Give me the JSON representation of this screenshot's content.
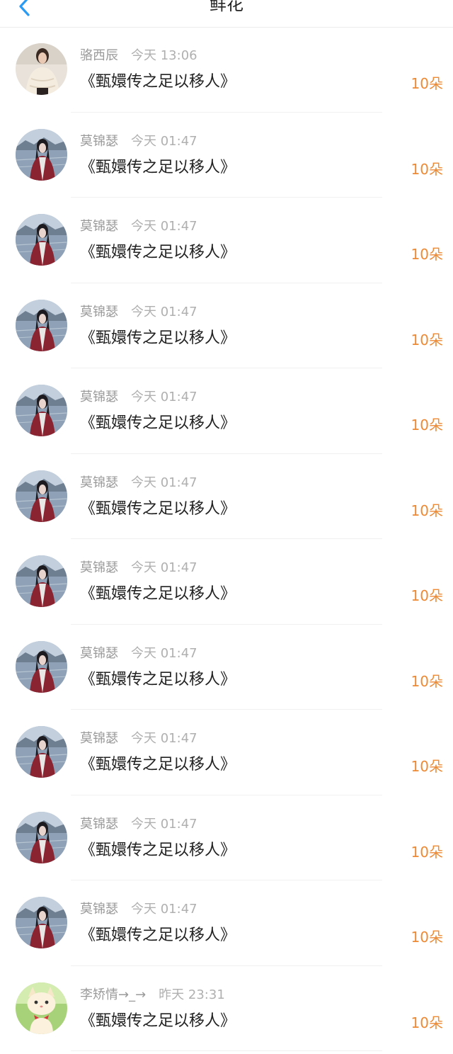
{
  "header": {
    "title": "鲜花",
    "back_icon": "chevron-left-icon",
    "accent": "#2b9af3"
  },
  "colors": {
    "amount": "#ec8a35",
    "name": "#9a9a9a",
    "text": "#222222"
  },
  "gifts": [
    {
      "user": "骆西辰",
      "time": "今天 13:06",
      "work": "《甄嬛传之足以移人》",
      "amount": "10朵",
      "avatar": "woman-lace-top-avatar"
    },
    {
      "user": "莫锦瑟",
      "time": "今天 01:47",
      "work": "《甄嬛传之足以移人》",
      "amount": "10朵",
      "avatar": "woman-lakeside-avatar"
    },
    {
      "user": "莫锦瑟",
      "time": "今天 01:47",
      "work": "《甄嬛传之足以移人》",
      "amount": "10朵",
      "avatar": "woman-lakeside-avatar"
    },
    {
      "user": "莫锦瑟",
      "time": "今天 01:47",
      "work": "《甄嬛传之足以移人》",
      "amount": "10朵",
      "avatar": "woman-lakeside-avatar"
    },
    {
      "user": "莫锦瑟",
      "time": "今天 01:47",
      "work": "《甄嬛传之足以移人》",
      "amount": "10朵",
      "avatar": "woman-lakeside-avatar"
    },
    {
      "user": "莫锦瑟",
      "time": "今天 01:47",
      "work": "《甄嬛传之足以移人》",
      "amount": "10朵",
      "avatar": "woman-lakeside-avatar"
    },
    {
      "user": "莫锦瑟",
      "time": "今天 01:47",
      "work": "《甄嬛传之足以移人》",
      "amount": "10朵",
      "avatar": "woman-lakeside-avatar"
    },
    {
      "user": "莫锦瑟",
      "time": "今天 01:47",
      "work": "《甄嬛传之足以移人》",
      "amount": "10朵",
      "avatar": "woman-lakeside-avatar"
    },
    {
      "user": "莫锦瑟",
      "time": "今天 01:47",
      "work": "《甄嬛传之足以移人》",
      "amount": "10朵",
      "avatar": "woman-lakeside-avatar"
    },
    {
      "user": "莫锦瑟",
      "time": "今天 01:47",
      "work": "《甄嬛传之足以移人》",
      "amount": "10朵",
      "avatar": "woman-lakeside-avatar"
    },
    {
      "user": "莫锦瑟",
      "time": "今天 01:47",
      "work": "《甄嬛传之足以移人》",
      "amount": "10朵",
      "avatar": "woman-lakeside-avatar"
    },
    {
      "user": "李矫情→_→",
      "time": "昨天 23:31",
      "work": "《甄嬛传之足以移人》",
      "amount": "10朵",
      "avatar": "cartoon-cat-avatar"
    }
  ]
}
